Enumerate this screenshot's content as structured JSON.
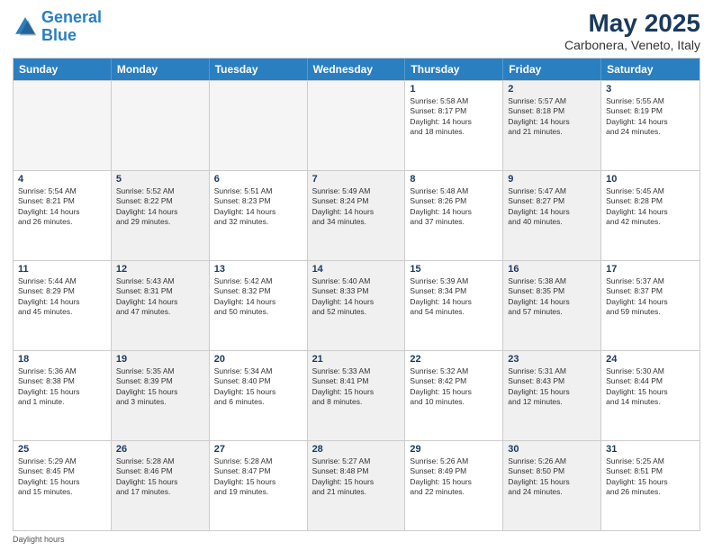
{
  "logo": {
    "line1": "General",
    "line2": "Blue"
  },
  "title": "May 2025",
  "subtitle": "Carbonera, Veneto, Italy",
  "header_days": [
    "Sunday",
    "Monday",
    "Tuesday",
    "Wednesday",
    "Thursday",
    "Friday",
    "Saturday"
  ],
  "footer": "Daylight hours",
  "weeks": [
    [
      {
        "day": "",
        "info": "",
        "empty": true
      },
      {
        "day": "",
        "info": "",
        "empty": true
      },
      {
        "day": "",
        "info": "",
        "empty": true
      },
      {
        "day": "",
        "info": "",
        "empty": true
      },
      {
        "day": "1",
        "info": "Sunrise: 5:58 AM\nSunset: 8:17 PM\nDaylight: 14 hours\nand 18 minutes.",
        "shaded": false
      },
      {
        "day": "2",
        "info": "Sunrise: 5:57 AM\nSunset: 8:18 PM\nDaylight: 14 hours\nand 21 minutes.",
        "shaded": true
      },
      {
        "day": "3",
        "info": "Sunrise: 5:55 AM\nSunset: 8:19 PM\nDaylight: 14 hours\nand 24 minutes.",
        "shaded": false
      }
    ],
    [
      {
        "day": "4",
        "info": "Sunrise: 5:54 AM\nSunset: 8:21 PM\nDaylight: 14 hours\nand 26 minutes.",
        "shaded": false
      },
      {
        "day": "5",
        "info": "Sunrise: 5:52 AM\nSunset: 8:22 PM\nDaylight: 14 hours\nand 29 minutes.",
        "shaded": true
      },
      {
        "day": "6",
        "info": "Sunrise: 5:51 AM\nSunset: 8:23 PM\nDaylight: 14 hours\nand 32 minutes.",
        "shaded": false
      },
      {
        "day": "7",
        "info": "Sunrise: 5:49 AM\nSunset: 8:24 PM\nDaylight: 14 hours\nand 34 minutes.",
        "shaded": true
      },
      {
        "day": "8",
        "info": "Sunrise: 5:48 AM\nSunset: 8:26 PM\nDaylight: 14 hours\nand 37 minutes.",
        "shaded": false
      },
      {
        "day": "9",
        "info": "Sunrise: 5:47 AM\nSunset: 8:27 PM\nDaylight: 14 hours\nand 40 minutes.",
        "shaded": true
      },
      {
        "day": "10",
        "info": "Sunrise: 5:45 AM\nSunset: 8:28 PM\nDaylight: 14 hours\nand 42 minutes.",
        "shaded": false
      }
    ],
    [
      {
        "day": "11",
        "info": "Sunrise: 5:44 AM\nSunset: 8:29 PM\nDaylight: 14 hours\nand 45 minutes.",
        "shaded": false
      },
      {
        "day": "12",
        "info": "Sunrise: 5:43 AM\nSunset: 8:31 PM\nDaylight: 14 hours\nand 47 minutes.",
        "shaded": true
      },
      {
        "day": "13",
        "info": "Sunrise: 5:42 AM\nSunset: 8:32 PM\nDaylight: 14 hours\nand 50 minutes.",
        "shaded": false
      },
      {
        "day": "14",
        "info": "Sunrise: 5:40 AM\nSunset: 8:33 PM\nDaylight: 14 hours\nand 52 minutes.",
        "shaded": true
      },
      {
        "day": "15",
        "info": "Sunrise: 5:39 AM\nSunset: 8:34 PM\nDaylight: 14 hours\nand 54 minutes.",
        "shaded": false
      },
      {
        "day": "16",
        "info": "Sunrise: 5:38 AM\nSunset: 8:35 PM\nDaylight: 14 hours\nand 57 minutes.",
        "shaded": true
      },
      {
        "day": "17",
        "info": "Sunrise: 5:37 AM\nSunset: 8:37 PM\nDaylight: 14 hours\nand 59 minutes.",
        "shaded": false
      }
    ],
    [
      {
        "day": "18",
        "info": "Sunrise: 5:36 AM\nSunset: 8:38 PM\nDaylight: 15 hours\nand 1 minute.",
        "shaded": false
      },
      {
        "day": "19",
        "info": "Sunrise: 5:35 AM\nSunset: 8:39 PM\nDaylight: 15 hours\nand 3 minutes.",
        "shaded": true
      },
      {
        "day": "20",
        "info": "Sunrise: 5:34 AM\nSunset: 8:40 PM\nDaylight: 15 hours\nand 6 minutes.",
        "shaded": false
      },
      {
        "day": "21",
        "info": "Sunrise: 5:33 AM\nSunset: 8:41 PM\nDaylight: 15 hours\nand 8 minutes.",
        "shaded": true
      },
      {
        "day": "22",
        "info": "Sunrise: 5:32 AM\nSunset: 8:42 PM\nDaylight: 15 hours\nand 10 minutes.",
        "shaded": false
      },
      {
        "day": "23",
        "info": "Sunrise: 5:31 AM\nSunset: 8:43 PM\nDaylight: 15 hours\nand 12 minutes.",
        "shaded": true
      },
      {
        "day": "24",
        "info": "Sunrise: 5:30 AM\nSunset: 8:44 PM\nDaylight: 15 hours\nand 14 minutes.",
        "shaded": false
      }
    ],
    [
      {
        "day": "25",
        "info": "Sunrise: 5:29 AM\nSunset: 8:45 PM\nDaylight: 15 hours\nand 15 minutes.",
        "shaded": false
      },
      {
        "day": "26",
        "info": "Sunrise: 5:28 AM\nSunset: 8:46 PM\nDaylight: 15 hours\nand 17 minutes.",
        "shaded": true
      },
      {
        "day": "27",
        "info": "Sunrise: 5:28 AM\nSunset: 8:47 PM\nDaylight: 15 hours\nand 19 minutes.",
        "shaded": false
      },
      {
        "day": "28",
        "info": "Sunrise: 5:27 AM\nSunset: 8:48 PM\nDaylight: 15 hours\nand 21 minutes.",
        "shaded": true
      },
      {
        "day": "29",
        "info": "Sunrise: 5:26 AM\nSunset: 8:49 PM\nDaylight: 15 hours\nand 22 minutes.",
        "shaded": false
      },
      {
        "day": "30",
        "info": "Sunrise: 5:26 AM\nSunset: 8:50 PM\nDaylight: 15 hours\nand 24 minutes.",
        "shaded": true
      },
      {
        "day": "31",
        "info": "Sunrise: 5:25 AM\nSunset: 8:51 PM\nDaylight: 15 hours\nand 26 minutes.",
        "shaded": false
      }
    ]
  ]
}
